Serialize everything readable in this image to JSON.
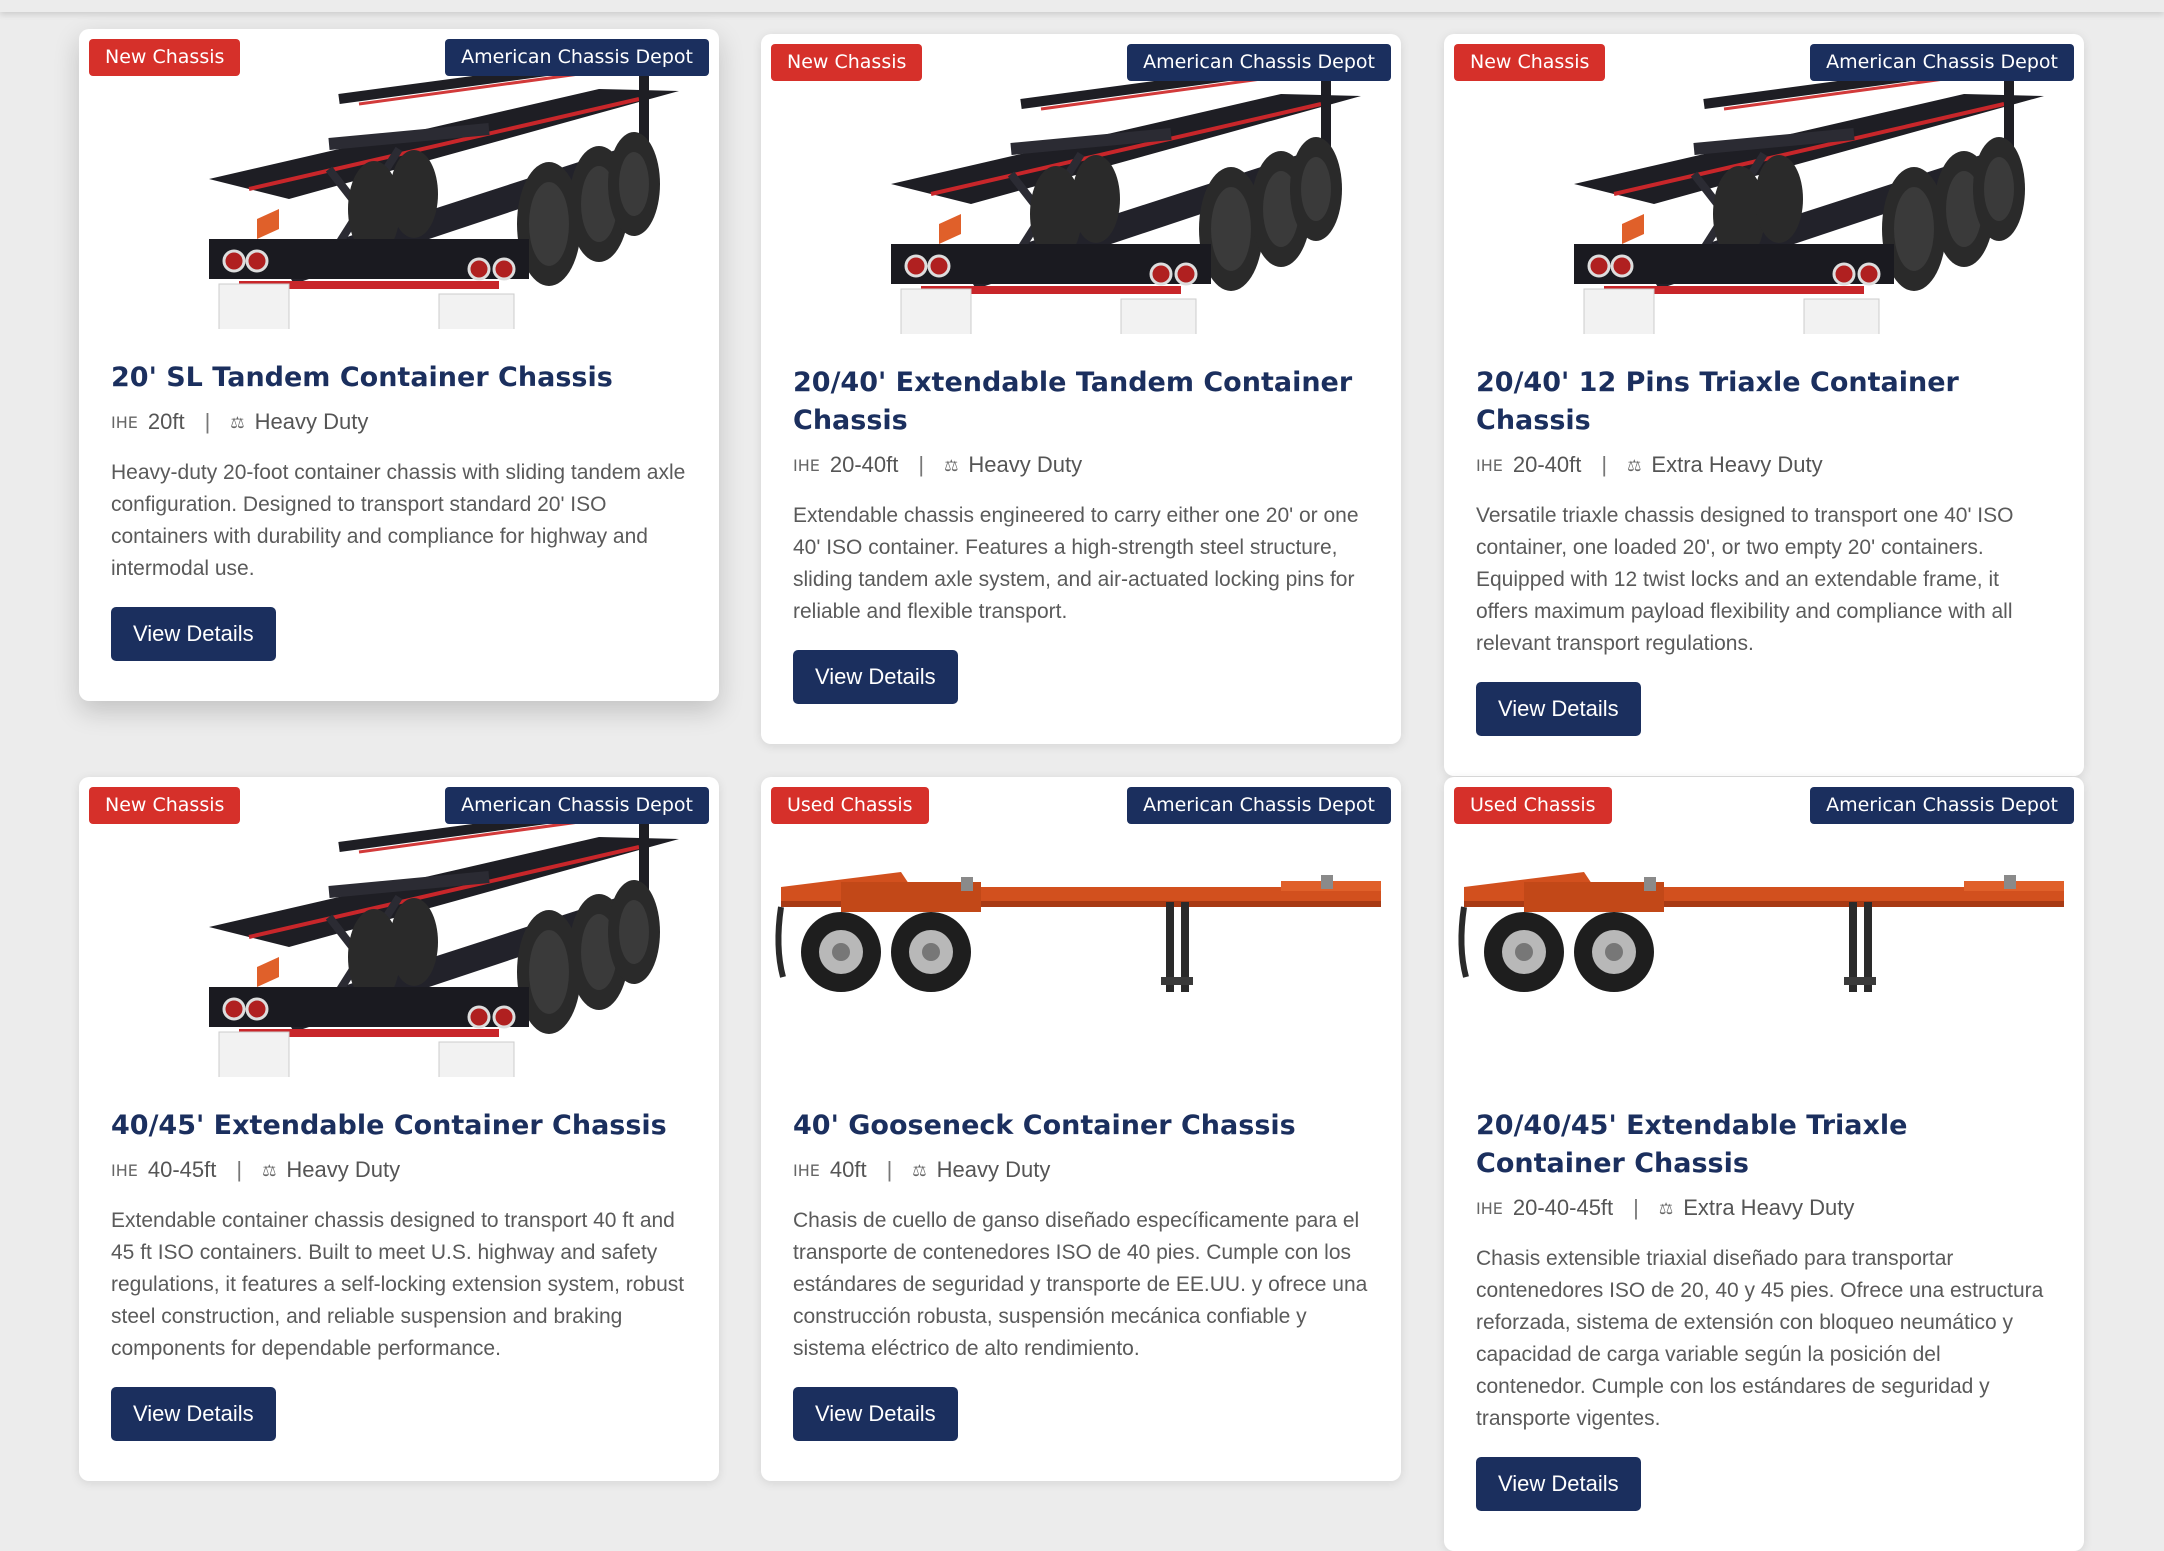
{
  "cards": [
    {
      "condition": "New Chassis",
      "brand": "American Chassis Depot",
      "image": "black-triaxle-chassis",
      "title": "20' SL Tandem Container Chassis",
      "size_icon": "ruler-icon",
      "size": "20ft",
      "duty_icon": "weight-icon",
      "duty": "Heavy Duty",
      "description": "Heavy-duty 20-foot container chassis with sliding tandem axle configuration. Designed to transport standard 20' ISO containers with durability and compliance for highway and intermodal use.",
      "button": "View Details"
    },
    {
      "condition": "New Chassis",
      "brand": "American Chassis Depot",
      "image": "black-triaxle-chassis",
      "title": "20/40' Extendable Tandem Container Chassis",
      "size_icon": "ruler-icon",
      "size": "20-40ft",
      "duty_icon": "weight-icon",
      "duty": "Heavy Duty",
      "description": "Extendable chassis engineered to carry either one 20' or one 40' ISO container. Features a high-strength steel structure, sliding tandem axle system, and air-actuated locking pins for reliable and flexible transport.",
      "button": "View Details"
    },
    {
      "condition": "New Chassis",
      "brand": "American Chassis Depot",
      "image": "black-triaxle-chassis",
      "title": "20/40' 12 Pins Triaxle Container Chassis",
      "size_icon": "ruler-icon",
      "size": "20-40ft",
      "duty_icon": "weight-icon",
      "duty": "Extra Heavy Duty",
      "description": "Versatile triaxle chassis designed to transport one 40' ISO container, one loaded 20', or two empty 20' containers. Equipped with 12 twist locks and an extendable frame, it offers maximum payload flexibility and compliance with all relevant transport regulations.",
      "button": "View Details"
    },
    {
      "condition": "New Chassis",
      "brand": "American Chassis Depot",
      "image": "black-triaxle-chassis",
      "title": "40/45' Extendable Container Chassis",
      "size_icon": "ruler-icon",
      "size": "40-45ft",
      "duty_icon": "weight-icon",
      "duty": "Heavy Duty",
      "description": "Extendable container chassis designed to transport 40 ft and 45 ft ISO containers. Built to meet U.S. highway and safety regulations, it features a self-locking extension system, robust steel construction, and reliable suspension and braking components for dependable performance.",
      "button": "View Details"
    },
    {
      "condition": "Used Chassis",
      "brand": "American Chassis Depot",
      "image": "orange-gooseneck-chassis",
      "title": "40' Gooseneck Container Chassis",
      "size_icon": "ruler-icon",
      "size": "40ft",
      "duty_icon": "weight-icon",
      "duty": "Heavy Duty",
      "description": "Chasis de cuello de ganso diseñado específicamente para el transporte de contenedores ISO de 40 pies. Cumple con los estándares de seguridad y transporte de EE.UU. y ofrece una construcción robusta, suspensión mecánica confiable y sistema eléctrico de alto rendimiento.",
      "button": "View Details"
    },
    {
      "condition": "Used Chassis",
      "brand": "American Chassis Depot",
      "image": "orange-gooseneck-chassis",
      "title": "20/40/45' Extendable Triaxle Container Chassis",
      "size_icon": "ruler-icon",
      "size": "20-40-45ft",
      "duty_icon": "weight-icon",
      "duty": "Extra Heavy Duty",
      "description": "Chasis extensible triaxial diseñado para transportar contenedores ISO de 20, 40 y 45 pies. Ofrece una estructura reforzada, sistema de extensión con bloqueo neumático y capacidad de carga variable según la posición del contenedor. Cumple con los estándares de seguridad y transporte vigentes.",
      "button": "View Details"
    }
  ],
  "colors": {
    "condition_badge": "#d6302a",
    "brand_badge": "#1b2f5e",
    "title": "#1b2f5e",
    "button": "#1b2f5e"
  }
}
